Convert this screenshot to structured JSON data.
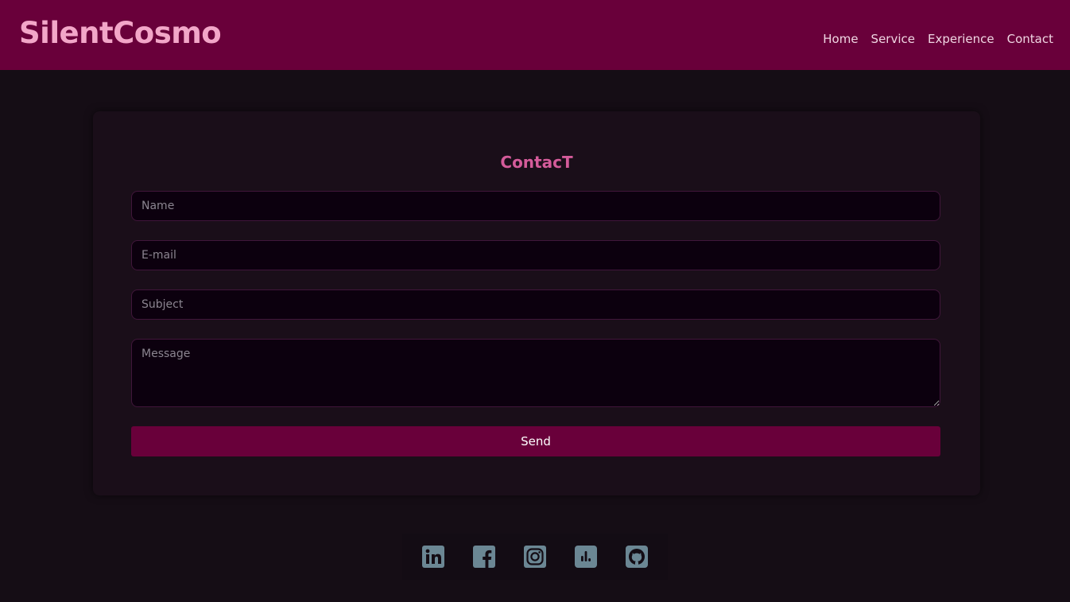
{
  "header": {
    "brand": "SilentCosmo",
    "nav": [
      "Home",
      "Service",
      "Experience",
      "Contact"
    ]
  },
  "contact": {
    "title": "ContacT",
    "name_placeholder": "Name",
    "email_placeholder": "E-mail",
    "subject_placeholder": "Subject",
    "message_placeholder": "Message",
    "send_label": "Send"
  },
  "social": {
    "icons": [
      "linkedin-icon",
      "facebook-icon",
      "instagram-icon",
      "chart-icon",
      "github-icon"
    ]
  },
  "colors": {
    "header_bg": "#69003a",
    "brand": "#f2a6c8",
    "title": "#d45b9a",
    "page_bg": "#150d15",
    "card_bg": "#1a0e19",
    "icon": "#6b8794"
  }
}
